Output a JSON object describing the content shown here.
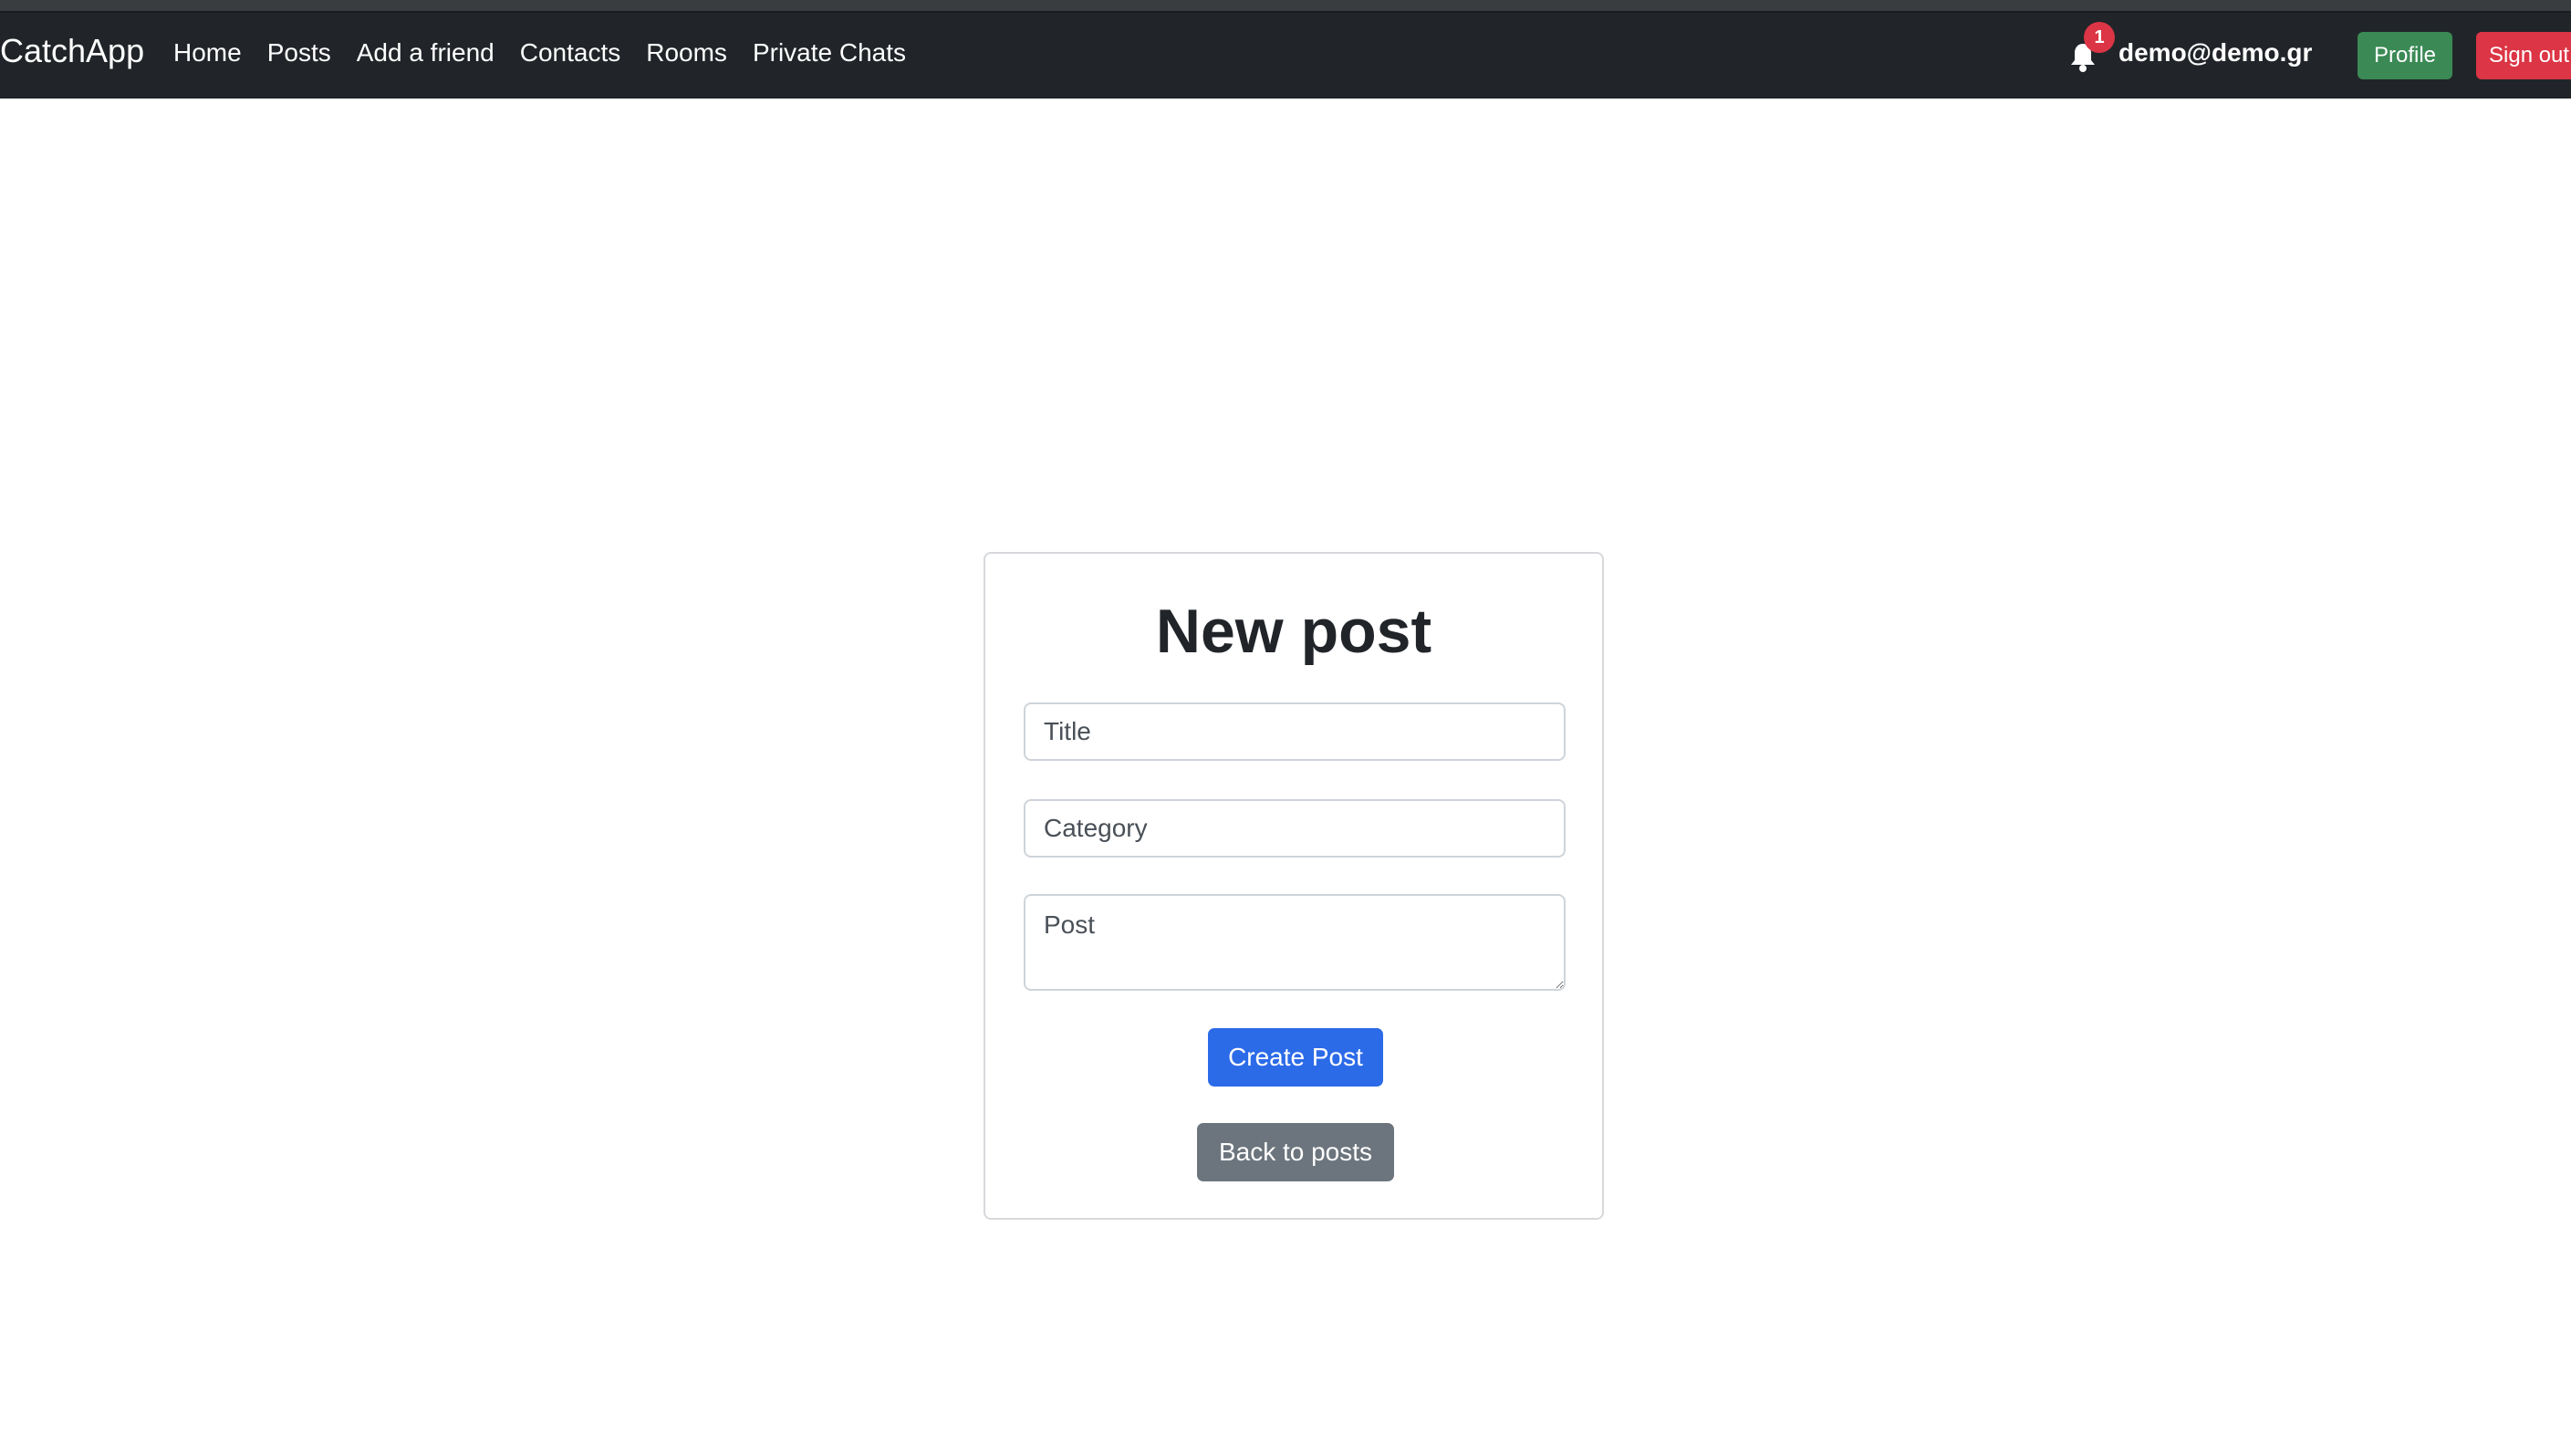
{
  "navbar": {
    "brand": "CatchApp",
    "links": [
      "Home",
      "Posts",
      "Add a friend",
      "Contacts",
      "Rooms",
      "Private Chats"
    ],
    "notifications": {
      "icon": "bell-icon",
      "count": "1"
    },
    "user_email": "demo@demo.gr",
    "profile_label": "Profile",
    "signout_label": "Sign out"
  },
  "form": {
    "heading": "New post",
    "title_placeholder": "Title",
    "category_placeholder": "Category",
    "post_placeholder": "Post",
    "create_label": "Create Post",
    "back_label": "Back to posts"
  },
  "colors": {
    "navbar_bg": "#212529",
    "primary": "#2c6be8",
    "secondary": "#6c757d",
    "success": "#3b8a55",
    "danger": "#dc3545"
  }
}
